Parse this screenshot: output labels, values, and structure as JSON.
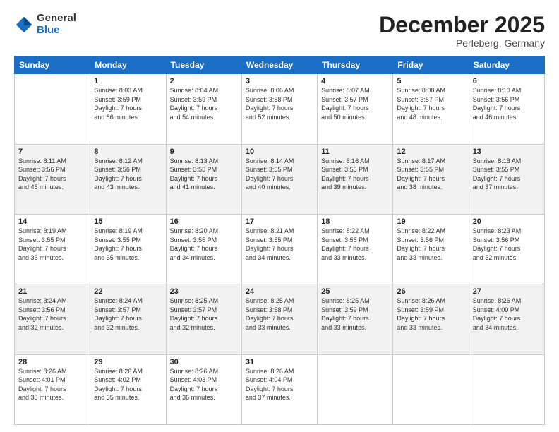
{
  "logo": {
    "general": "General",
    "blue": "Blue"
  },
  "header": {
    "month": "December 2025",
    "location": "Perleberg, Germany"
  },
  "weekdays": [
    "Sunday",
    "Monday",
    "Tuesday",
    "Wednesday",
    "Thursday",
    "Friday",
    "Saturday"
  ],
  "weeks": [
    [
      {
        "day": "",
        "info": ""
      },
      {
        "day": "1",
        "info": "Sunrise: 8:03 AM\nSunset: 3:59 PM\nDaylight: 7 hours\nand 56 minutes."
      },
      {
        "day": "2",
        "info": "Sunrise: 8:04 AM\nSunset: 3:59 PM\nDaylight: 7 hours\nand 54 minutes."
      },
      {
        "day": "3",
        "info": "Sunrise: 8:06 AM\nSunset: 3:58 PM\nDaylight: 7 hours\nand 52 minutes."
      },
      {
        "day": "4",
        "info": "Sunrise: 8:07 AM\nSunset: 3:57 PM\nDaylight: 7 hours\nand 50 minutes."
      },
      {
        "day": "5",
        "info": "Sunrise: 8:08 AM\nSunset: 3:57 PM\nDaylight: 7 hours\nand 48 minutes."
      },
      {
        "day": "6",
        "info": "Sunrise: 8:10 AM\nSunset: 3:56 PM\nDaylight: 7 hours\nand 46 minutes."
      }
    ],
    [
      {
        "day": "7",
        "info": "Sunrise: 8:11 AM\nSunset: 3:56 PM\nDaylight: 7 hours\nand 45 minutes."
      },
      {
        "day": "8",
        "info": "Sunrise: 8:12 AM\nSunset: 3:56 PM\nDaylight: 7 hours\nand 43 minutes."
      },
      {
        "day": "9",
        "info": "Sunrise: 8:13 AM\nSunset: 3:55 PM\nDaylight: 7 hours\nand 41 minutes."
      },
      {
        "day": "10",
        "info": "Sunrise: 8:14 AM\nSunset: 3:55 PM\nDaylight: 7 hours\nand 40 minutes."
      },
      {
        "day": "11",
        "info": "Sunrise: 8:16 AM\nSunset: 3:55 PM\nDaylight: 7 hours\nand 39 minutes."
      },
      {
        "day": "12",
        "info": "Sunrise: 8:17 AM\nSunset: 3:55 PM\nDaylight: 7 hours\nand 38 minutes."
      },
      {
        "day": "13",
        "info": "Sunrise: 8:18 AM\nSunset: 3:55 PM\nDaylight: 7 hours\nand 37 minutes."
      }
    ],
    [
      {
        "day": "14",
        "info": "Sunrise: 8:19 AM\nSunset: 3:55 PM\nDaylight: 7 hours\nand 36 minutes."
      },
      {
        "day": "15",
        "info": "Sunrise: 8:19 AM\nSunset: 3:55 PM\nDaylight: 7 hours\nand 35 minutes."
      },
      {
        "day": "16",
        "info": "Sunrise: 8:20 AM\nSunset: 3:55 PM\nDaylight: 7 hours\nand 34 minutes."
      },
      {
        "day": "17",
        "info": "Sunrise: 8:21 AM\nSunset: 3:55 PM\nDaylight: 7 hours\nand 34 minutes."
      },
      {
        "day": "18",
        "info": "Sunrise: 8:22 AM\nSunset: 3:55 PM\nDaylight: 7 hours\nand 33 minutes."
      },
      {
        "day": "19",
        "info": "Sunrise: 8:22 AM\nSunset: 3:56 PM\nDaylight: 7 hours\nand 33 minutes."
      },
      {
        "day": "20",
        "info": "Sunrise: 8:23 AM\nSunset: 3:56 PM\nDaylight: 7 hours\nand 32 minutes."
      }
    ],
    [
      {
        "day": "21",
        "info": "Sunrise: 8:24 AM\nSunset: 3:56 PM\nDaylight: 7 hours\nand 32 minutes."
      },
      {
        "day": "22",
        "info": "Sunrise: 8:24 AM\nSunset: 3:57 PM\nDaylight: 7 hours\nand 32 minutes."
      },
      {
        "day": "23",
        "info": "Sunrise: 8:25 AM\nSunset: 3:57 PM\nDaylight: 7 hours\nand 32 minutes."
      },
      {
        "day": "24",
        "info": "Sunrise: 8:25 AM\nSunset: 3:58 PM\nDaylight: 7 hours\nand 33 minutes."
      },
      {
        "day": "25",
        "info": "Sunrise: 8:25 AM\nSunset: 3:59 PM\nDaylight: 7 hours\nand 33 minutes."
      },
      {
        "day": "26",
        "info": "Sunrise: 8:26 AM\nSunset: 3:59 PM\nDaylight: 7 hours\nand 33 minutes."
      },
      {
        "day": "27",
        "info": "Sunrise: 8:26 AM\nSunset: 4:00 PM\nDaylight: 7 hours\nand 34 minutes."
      }
    ],
    [
      {
        "day": "28",
        "info": "Sunrise: 8:26 AM\nSunset: 4:01 PM\nDaylight: 7 hours\nand 35 minutes."
      },
      {
        "day": "29",
        "info": "Sunrise: 8:26 AM\nSunset: 4:02 PM\nDaylight: 7 hours\nand 35 minutes."
      },
      {
        "day": "30",
        "info": "Sunrise: 8:26 AM\nSunset: 4:03 PM\nDaylight: 7 hours\nand 36 minutes."
      },
      {
        "day": "31",
        "info": "Sunrise: 8:26 AM\nSunset: 4:04 PM\nDaylight: 7 hours\nand 37 minutes."
      },
      {
        "day": "",
        "info": ""
      },
      {
        "day": "",
        "info": ""
      },
      {
        "day": "",
        "info": ""
      }
    ]
  ]
}
